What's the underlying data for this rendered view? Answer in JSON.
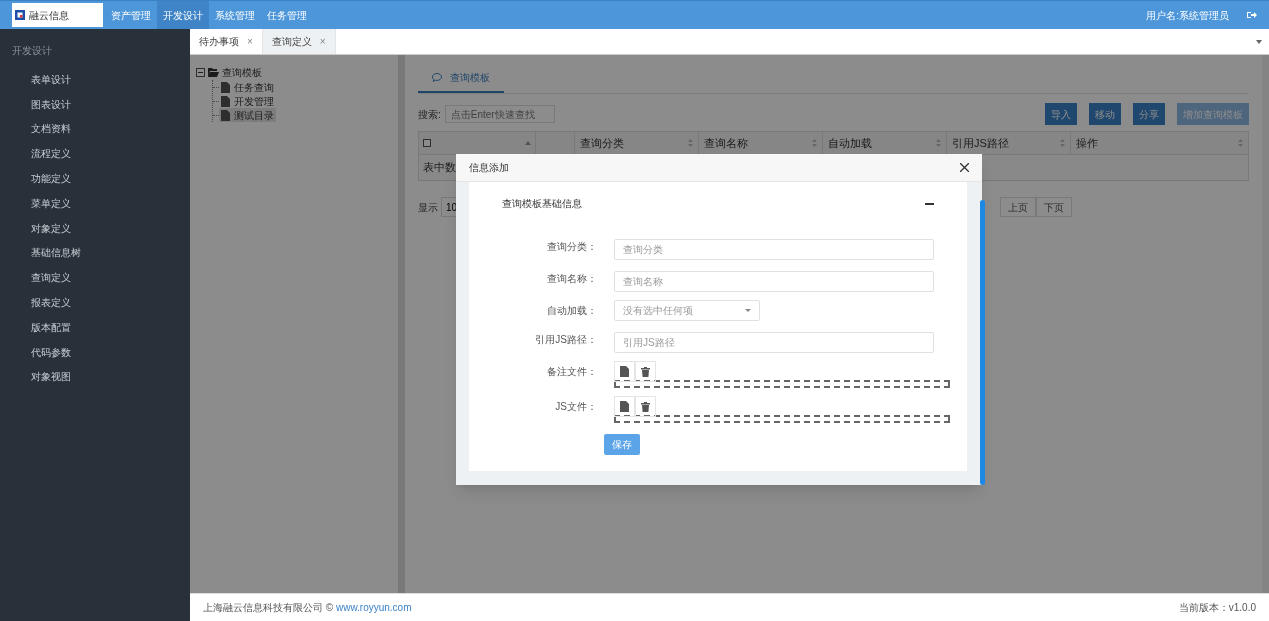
{
  "top_nav": {
    "logo_text": "融云信息",
    "items": [
      {
        "label": "资产管理",
        "selected": false
      },
      {
        "label": "开发设计",
        "selected": true
      },
      {
        "label": "系统管理",
        "selected": false
      },
      {
        "label": "任务管理",
        "selected": false
      }
    ],
    "user": "用户名:系统管理员"
  },
  "sidebar": {
    "section": "开发设计",
    "items": [
      "表单设计",
      "图表设计",
      "文档资料",
      "流程定义",
      "功能定义",
      "菜单定义",
      "对象定义",
      "基础信息树",
      "查询定义",
      "报表定义",
      "版本配置",
      "代码参数",
      "对象视图"
    ]
  },
  "tabs": [
    {
      "label": "待办事项",
      "selected": false,
      "close": "×"
    },
    {
      "label": "查询定义",
      "selected": true,
      "close": "×"
    }
  ],
  "tree": {
    "label": "查询模板",
    "expanded": true,
    "children": [
      {
        "label": "任务查询",
        "selected": false
      },
      {
        "label": "开发管理",
        "selected": false
      },
      {
        "label": "测试目录",
        "selected": true
      }
    ]
  },
  "panel": {
    "tab": "查询模板",
    "search_label": "搜索:",
    "search_placeholder": "点击Enter快速查找",
    "buttons": [
      {
        "label": "导入",
        "disabled": false
      },
      {
        "label": "移动",
        "disabled": false
      },
      {
        "label": "分享",
        "disabled": false
      },
      {
        "label": "增加查询模板",
        "disabled": true
      }
    ],
    "table": {
      "select_all": {
        "checked": false
      },
      "columns": [
        "查询分类",
        "查询名称",
        "自动加载",
        "引用JS路径",
        "操作"
      ],
      "empty_text": "表中数"
    },
    "page_size_label": "显示",
    "page_size": "10",
    "pager": [
      "上页",
      "下页"
    ]
  },
  "dialog": {
    "title": "信息添加",
    "section": "查询模板基础信息",
    "expanded": true,
    "fields": [
      {
        "kind": "text",
        "label": "查询分类：",
        "placeholder": "查询分类"
      },
      {
        "kind": "text",
        "label": "查询名称：",
        "placeholder": "查询名称"
      },
      {
        "kind": "select",
        "label": "自动加载：",
        "value": "没有选中任何项"
      },
      {
        "kind": "text",
        "label": "引用JS路径：",
        "placeholder": "引用JS路径"
      },
      {
        "kind": "file",
        "label": "备注文件："
      },
      {
        "kind": "file",
        "label": "JS文件："
      }
    ],
    "save": "保存"
  },
  "footer": {
    "company": "上海融云信息科技有限公司 ©",
    "link": "www.royyun.com",
    "version": "当前版本：v1.0.0"
  }
}
